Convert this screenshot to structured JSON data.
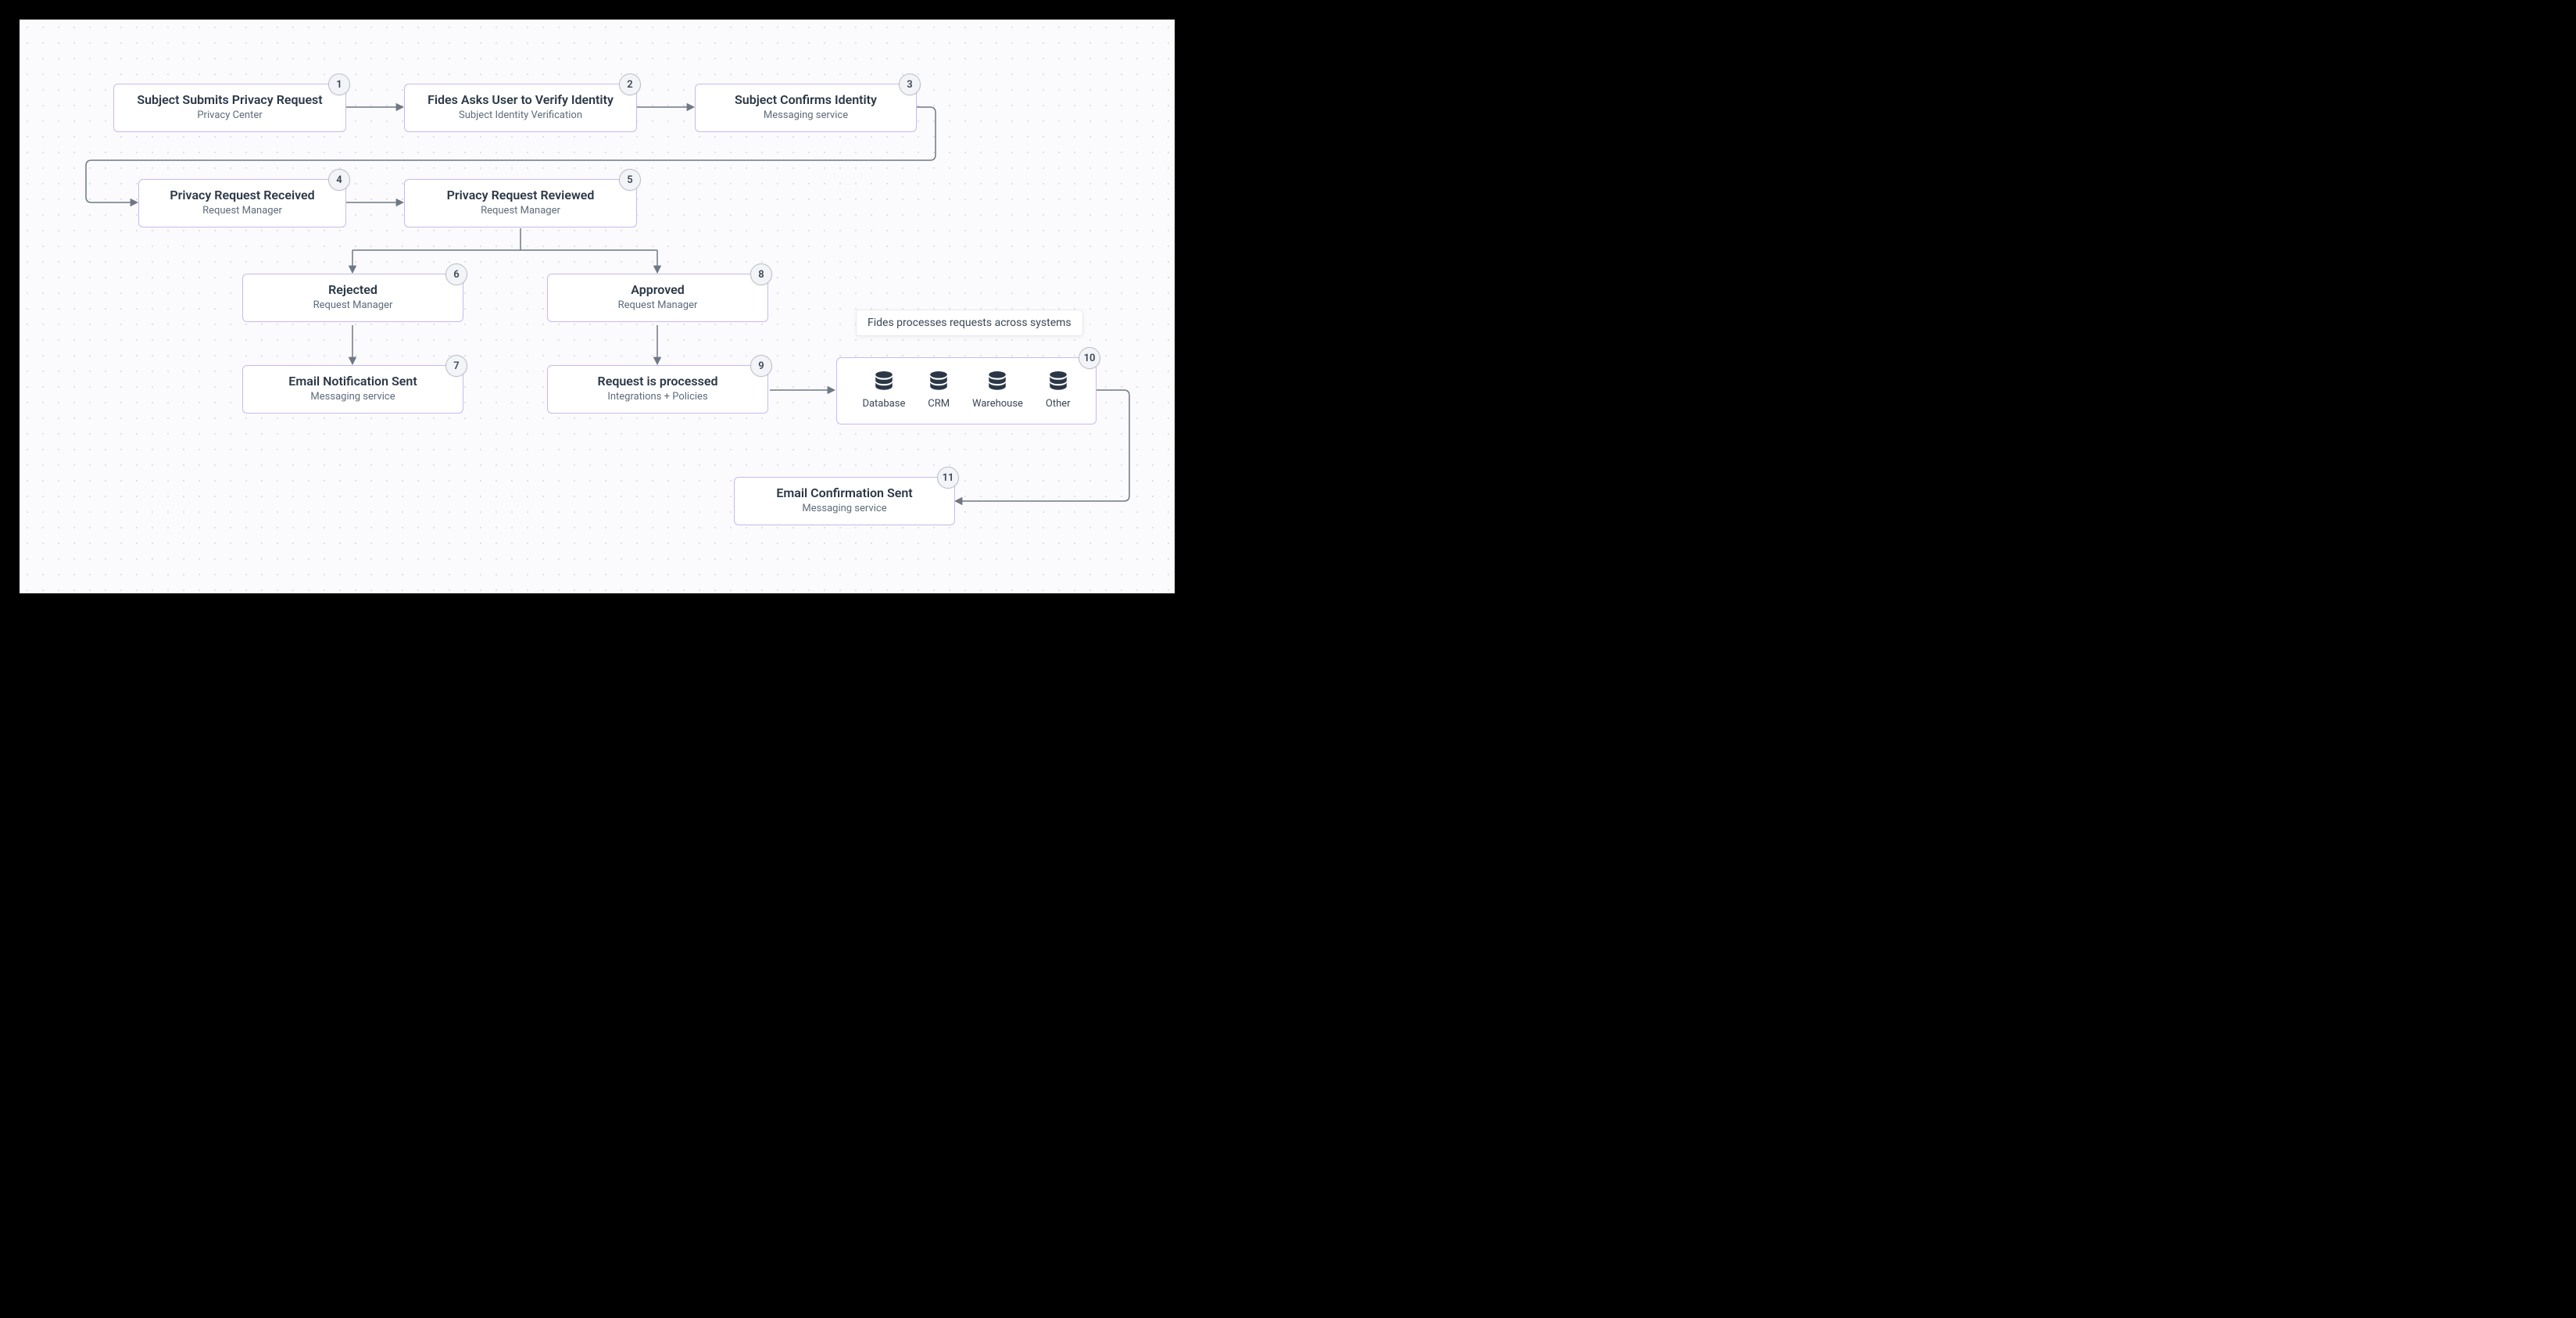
{
  "nodes": {
    "n1": {
      "num": "1",
      "title": "Subject Submits Privacy Request",
      "subtitle": "Privacy Center"
    },
    "n2": {
      "num": "2",
      "title": "Fides Asks User to Verify Identity",
      "subtitle": "Subject Identity Verification"
    },
    "n3": {
      "num": "3",
      "title": "Subject Confirms Identity",
      "subtitle": "Messaging service"
    },
    "n4": {
      "num": "4",
      "title": "Privacy Request Received",
      "subtitle": "Request Manager"
    },
    "n5": {
      "num": "5",
      "title": "Privacy Request Reviewed",
      "subtitle": "Request Manager"
    },
    "n6": {
      "num": "6",
      "title": "Rejected",
      "subtitle": "Request Manager"
    },
    "n7": {
      "num": "7",
      "title": "Email Notification Sent",
      "subtitle": "Messaging service"
    },
    "n8": {
      "num": "8",
      "title": "Approved",
      "subtitle": "Request Manager"
    },
    "n9": {
      "num": "9",
      "title": "Request is processed",
      "subtitle": "Integrations + Policies"
    },
    "n10": {
      "num": "10"
    },
    "n11": {
      "num": "11",
      "title": "Email Confirmation Sent",
      "subtitle": "Messaging service"
    }
  },
  "systemsLabel": "Fides processes requests across systems",
  "systems": [
    {
      "label": "Database"
    },
    {
      "label": "CRM"
    },
    {
      "label": "Warehouse"
    },
    {
      "label": "Other"
    }
  ]
}
